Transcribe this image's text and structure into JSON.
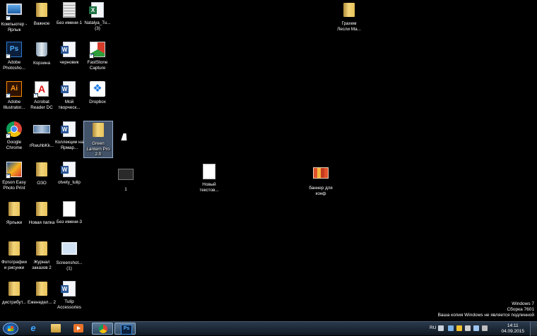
{
  "desktop": {
    "icons": [
      {
        "label": "Компьютер - Ярлык",
        "icon": "computer-icon",
        "glyph": "computer",
        "shortcut": true
      },
      {
        "label": "Важное",
        "icon": "folder-icon",
        "glyph": "folder"
      },
      {
        "label": "Без имени-1",
        "icon": "document-icon",
        "glyph": "bez"
      },
      {
        "label": "Natalya_Tu... (3)",
        "icon": "excel-document-icon",
        "glyph": "excel"
      },
      {
        "label": "Грахем Лесли Ма...",
        "icon": "folder-icon",
        "glyph": "folder"
      },
      {
        "label": "Adobe Photosho...",
        "icon": "photoshop-icon",
        "glyph": "ps",
        "text": "Ps",
        "shortcut": true
      },
      {
        "label": "Корзина",
        "icon": "recycle-bin-icon",
        "glyph": "bin"
      },
      {
        "label": "черновик",
        "icon": "word-document-icon",
        "glyph": "word"
      },
      {
        "label": "FastStone Capture",
        "icon": "faststone-capture-icon",
        "glyph": "fast",
        "shortcut": true
      },
      {
        "label": "Adobe Illustrator...",
        "icon": "illustrator-icon",
        "glyph": "ai",
        "text": "Ai",
        "shortcut": true
      },
      {
        "label": "Acrobat Reader DC",
        "icon": "acrobat-reader-icon",
        "glyph": "acro",
        "text": "A",
        "shortcut": true
      },
      {
        "label": "Мой творческ...",
        "icon": "word-document-icon",
        "glyph": "word"
      },
      {
        "label": "Dropbox",
        "icon": "dropbox-icon",
        "glyph": "dropbox",
        "text": "❖"
      },
      {
        "label": "Google Chrome",
        "icon": "chrome-icon",
        "glyph": "chrome",
        "shortcut": true
      },
      {
        "label": "rRwuhbKk...",
        "icon": "image-file-icon",
        "glyph": "photo"
      },
      {
        "label": "Коллекции на Ярмар...",
        "icon": "word-document-icon",
        "glyph": "word"
      },
      {
        "label": "Green Lantern Pro 2.0",
        "icon": "folder-icon",
        "glyph": "folder",
        "selected": true
      },
      {
        "label": "Epson Easy Photo Print",
        "icon": "epson-photo-print-icon",
        "glyph": "epson",
        "shortcut": true
      },
      {
        "label": "ОЗО",
        "icon": "folder-icon",
        "glyph": "folder"
      },
      {
        "label": "otvety_tulip",
        "icon": "word-document-icon",
        "glyph": "word"
      },
      {
        "label": "1",
        "icon": "image-file-icon",
        "glyph": "dark"
      },
      {
        "label": "Новый текстов...",
        "icon": "text-document-icon",
        "glyph": "generic"
      },
      {
        "label": "баннер для конф",
        "icon": "image-file-icon",
        "glyph": "mosaic"
      },
      {
        "label": "Ярлыки",
        "icon": "folder-icon",
        "glyph": "folder"
      },
      {
        "label": "Новая папка",
        "icon": "folder-icon",
        "glyph": "folder"
      },
      {
        "label": "Без имени-3",
        "icon": "document-icon",
        "glyph": "generic"
      },
      {
        "label": "Фотографии и рисунки",
        "icon": "folder-icon",
        "glyph": "folder"
      },
      {
        "label": "Журнал заказов 2",
        "icon": "folder-icon",
        "glyph": "folder"
      },
      {
        "label": "Screenshot... (1)",
        "icon": "screenshot-icon",
        "glyph": "shot"
      },
      {
        "label": "дистрибут...",
        "icon": "folder-icon",
        "glyph": "folder"
      },
      {
        "label": "Еженедел... 2",
        "icon": "folder-icon",
        "glyph": "folder"
      },
      {
        "label": "Tulip Accessories",
        "icon": "word-document-icon",
        "glyph": "word"
      }
    ]
  },
  "watermark": {
    "line1": "Windows 7",
    "line2": "Сборка 7601",
    "line3": "Ваша копия Windows не является подлинной"
  },
  "taskbar": {
    "ie_glyph": "e",
    "ps_glyph": "Ps",
    "language": "RU",
    "time": "14:11",
    "date": "04.09.2015"
  }
}
